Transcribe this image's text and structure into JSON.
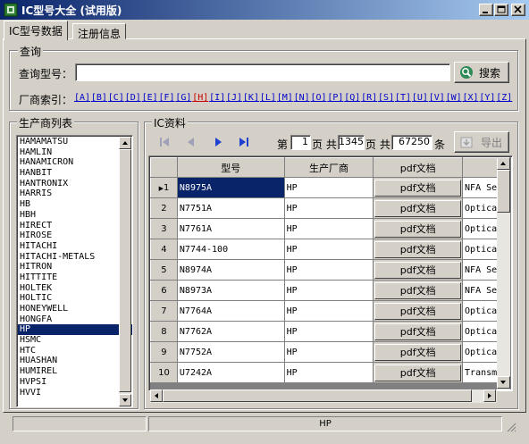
{
  "window": {
    "title": "IC型号大全 (试用版)",
    "colors": {
      "title_gradient_start": "#0a246a",
      "title_gradient_end": "#a6caf0",
      "face": "#d4d0c8",
      "link": "#0000cc",
      "active_link": "#cc0000",
      "selection": "#0a246a"
    }
  },
  "tabs": [
    {
      "label": "IC型号数据",
      "active": true
    },
    {
      "label": "注册信息",
      "active": false
    }
  ],
  "query": {
    "group_title": "查询",
    "model_label": "查询型号：",
    "model_value": "",
    "search_label": "搜索",
    "index_label": "厂商索引：",
    "index_letters": [
      "[A]",
      "[B]",
      "[C]",
      "[D]",
      "[E]",
      "[F]",
      "[G]",
      "[H]",
      "[I]",
      "[J]",
      "[K]",
      "[L]",
      "[M]",
      "[N]",
      "[O]",
      "[P]",
      "[Q]",
      "[R]",
      "[S]",
      "[T]",
      "[U]",
      "[V]",
      "[W]",
      "[X]",
      "[Y]",
      "[Z]"
    ],
    "active_letter": "[H]"
  },
  "manufacturers": {
    "group_title": "生产商列表",
    "items": [
      "HAMAMATSU",
      "HAMLIN",
      "HANAMICRON",
      "HANBIT",
      "HANTRONIX",
      "HARRIS",
      "HB",
      "HBH",
      "HIRECT",
      "HIROSE",
      "HITACHI",
      "HITACHI-METALS",
      "HITRON",
      "HITTITE",
      "HOLTEK",
      "HOLTIC",
      "HONEYWELL",
      "HONGFA",
      "HP",
      "HSMC",
      "HTC",
      "HUASHAN",
      "HUMIREL",
      "HVPSI",
      "HVVI"
    ],
    "selected": "HP"
  },
  "ic_data": {
    "group_title": "IC资料",
    "pager": {
      "page_prefix": "第",
      "current_page": "1",
      "page_mid": "页 共",
      "total_pages": "1345",
      "pages_suffix": "页 共",
      "total_records": "67250",
      "records_suffix": "条"
    },
    "export_label": "导出",
    "columns": [
      "型号",
      "生产厂商",
      "pdf文档"
    ],
    "rows": [
      {
        "no": "1",
        "model": "N8975A",
        "maker": "HP",
        "pdf": "pdf文档",
        "desc": "NFA Se"
      },
      {
        "no": "2",
        "model": "N7751A",
        "maker": "HP",
        "pdf": "pdf文档",
        "desc": "Optica"
      },
      {
        "no": "3",
        "model": "N7761A",
        "maker": "HP",
        "pdf": "pdf文档",
        "desc": "Optica"
      },
      {
        "no": "4",
        "model": "N7744-100",
        "maker": "HP",
        "pdf": "pdf文档",
        "desc": "Optica"
      },
      {
        "no": "5",
        "model": "N8974A",
        "maker": "HP",
        "pdf": "pdf文档",
        "desc": "NFA Se"
      },
      {
        "no": "6",
        "model": "N8973A",
        "maker": "HP",
        "pdf": "pdf文档",
        "desc": "NFA Se"
      },
      {
        "no": "7",
        "model": "N7764A",
        "maker": "HP",
        "pdf": "pdf文档",
        "desc": "Optica"
      },
      {
        "no": "8",
        "model": "N7762A",
        "maker": "HP",
        "pdf": "pdf文档",
        "desc": "Optica"
      },
      {
        "no": "9",
        "model": "N7752A",
        "maker": "HP",
        "pdf": "pdf文档",
        "desc": "Optica"
      },
      {
        "no": "10",
        "model": "U7242A",
        "maker": "HP",
        "pdf": "pdf文档",
        "desc": "Transm"
      }
    ],
    "current_row_marker": "▶"
  },
  "status": {
    "left": "",
    "center": "HP"
  }
}
